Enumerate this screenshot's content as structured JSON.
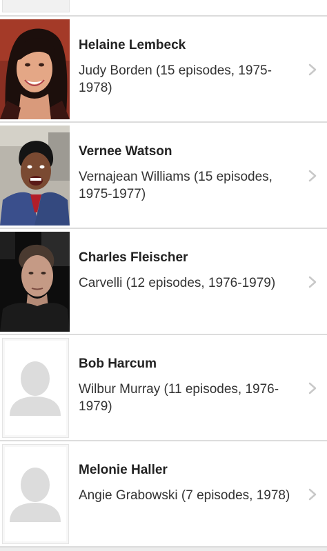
{
  "cast_list": {
    "items": [
      {
        "name": "Helaine Lembeck",
        "role": "Judy Borden (15 episodes, 1975-1978)",
        "photo": "portrait-photo-smiling-woman"
      },
      {
        "name": "Vernee Watson",
        "role": "Vernajean Williams (15 episodes, 1975-1977)",
        "photo": "portrait-photo-laughing-woman"
      },
      {
        "name": "Charles Fleischer",
        "role": "Carvelli (12 episodes, 1976-1979)",
        "photo": "portrait-photo-man"
      },
      {
        "name": "Bob Harcum",
        "role": "Wilbur Murray (11 episodes, 1976-1979)",
        "photo": "placeholder-person-icon"
      },
      {
        "name": "Melonie Haller",
        "role": "Angie Grabowski (7 episodes, 1978)",
        "photo": "placeholder-person-icon"
      }
    ]
  },
  "colors": {
    "background": "#ececec",
    "row_background": "#ffffff",
    "divider": "#dcdcdc",
    "name_text": "#222222",
    "role_text": "#333333",
    "chevron": "#c8c8c8",
    "placeholder_silhouette": "#dcdcdc"
  }
}
